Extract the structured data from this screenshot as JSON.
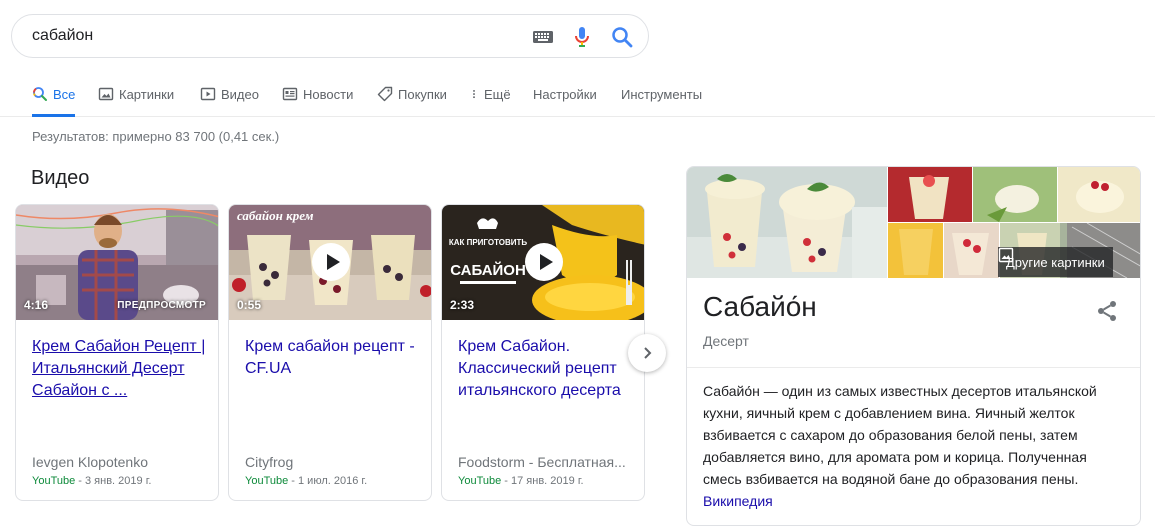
{
  "search": {
    "query": "сабайон"
  },
  "tabs": [
    {
      "label": "Все",
      "icon": "search-icon"
    },
    {
      "label": "Картинки",
      "icon": "image-icon"
    },
    {
      "label": "Видео",
      "icon": "video-icon"
    },
    {
      "label": "Новости",
      "icon": "news-icon"
    },
    {
      "label": "Покупки",
      "icon": "tag-icon"
    },
    {
      "label": "Ещё",
      "icon": "more-vert-icon"
    },
    {
      "label": "Настройки"
    },
    {
      "label": "Инструменты"
    }
  ],
  "stats": "Результатов: примерно 83 700 (0,41 сек.)",
  "videos_heading": "Видео",
  "videos": [
    {
      "duration": "4:16",
      "preview": "ПРЕДПРОСМОТР",
      "title": "Крем Сабайон Рецепт | Итальянский Десерт Сабайон с ...",
      "channel": "Ievgen Klopotenko",
      "source": "YouTube",
      "date": " - 3 янв. 2019 г."
    },
    {
      "duration": "0:55",
      "overlay": "сабайон крем",
      "title": "Крем сабайон рецепт - CF.UA",
      "channel": "Cityfrog",
      "source": "YouTube",
      "date": " - 1 июл. 2016 г."
    },
    {
      "duration": "2:33",
      "overlay_small": "КАК ПРИГОТОВИТЬ",
      "overlay": "САБАЙОН",
      "title": "Крем Сабайон. Классический рецепт итальянского десерта",
      "channel": "Foodstorm - Бесплатная...",
      "source": "YouTube",
      "date": " - 17 янв. 2019 г."
    }
  ],
  "knowledge_panel": {
    "more_images": "Другие картинки",
    "title": "Сабайо́н",
    "subtitle": "Десерт",
    "description": "Сабайо́н — один из самых известных десертов итальянской кухни, яичный крем с добавлением вина. Яичный желток взбивается с сахаром до образования белой пены, затем добавляется вино, для аромата ром и корица. Полученная смесь взбивается на водяной бане до образования пены.",
    "source_link": "Википедия"
  },
  "colors": {
    "accent": "#1a73e8",
    "link": "#1a0dab",
    "url_green": "#0d8a3a"
  }
}
